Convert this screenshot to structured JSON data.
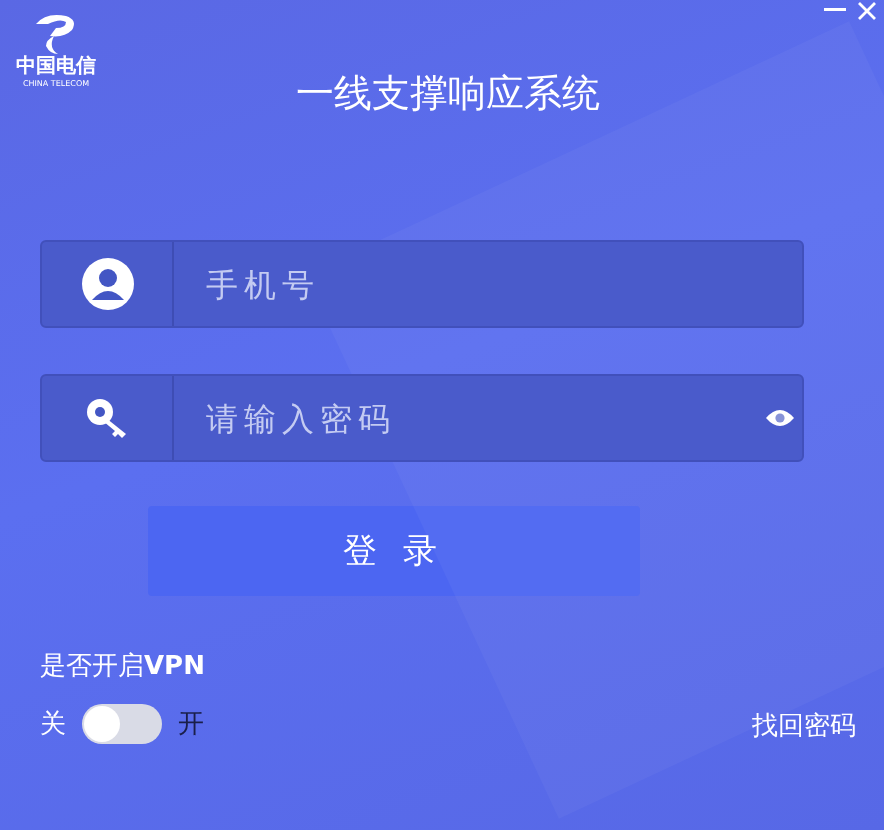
{
  "window": {
    "controls": [
      {
        "kind": "minimize"
      },
      {
        "kind": "close"
      }
    ]
  },
  "logo": {
    "name": "中国电信",
    "subtitle": "CHINA TELECOM"
  },
  "title": "一线支撑响应系统",
  "fields": [
    {
      "kind": "phone",
      "placeholder": "手机号",
      "reveal": false
    },
    {
      "kind": "password",
      "placeholder": "请输入密码",
      "reveal": true
    }
  ],
  "login_button": "登 录",
  "vpn": {
    "label": "是否开启**VPN**",
    "off_label": "关",
    "on_label": "开",
    "on": false
  },
  "forgot_link": "找回密码"
}
